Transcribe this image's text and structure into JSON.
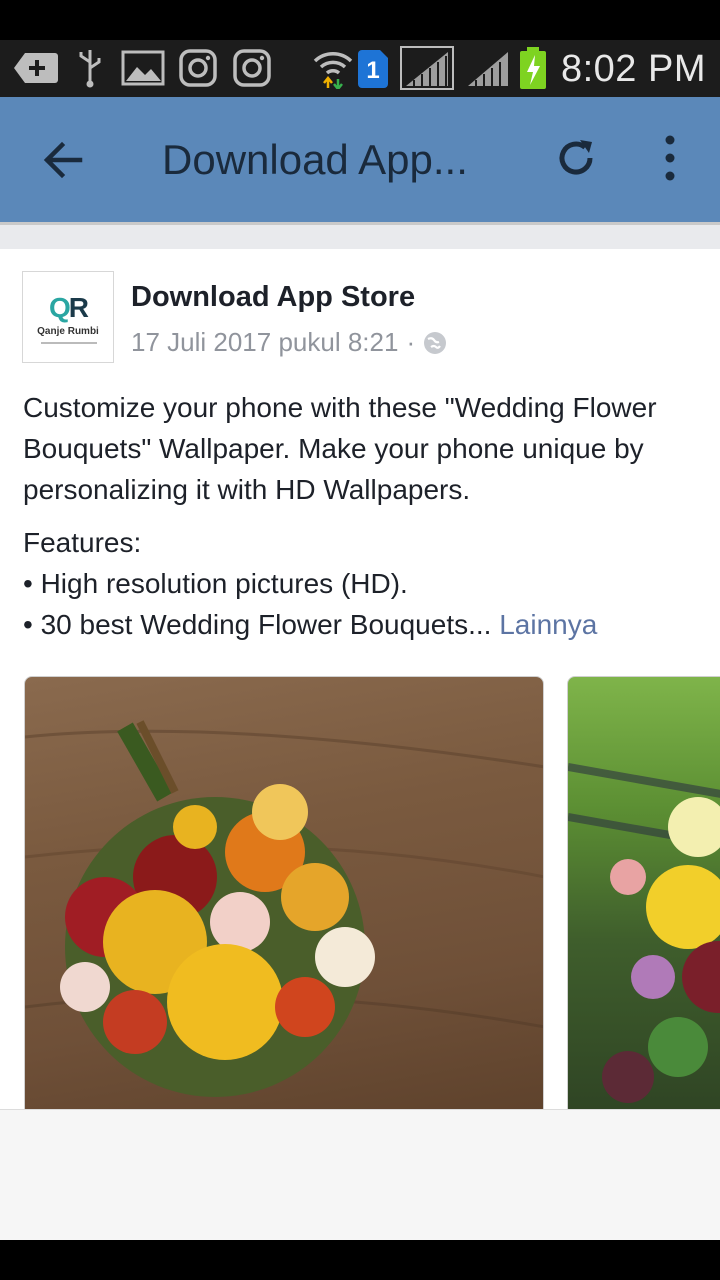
{
  "status_bar": {
    "time": "8:02 PM",
    "icons": [
      "add-notification-icon",
      "usb-icon",
      "image-icon",
      "instagram-icon",
      "instagram-icon",
      "wifi-icon",
      "sim-1-icon",
      "signal-icon",
      "signal-icon",
      "battery-charging-icon"
    ],
    "sim_label": "1"
  },
  "app_bar": {
    "title": "Download App...",
    "background": "#5b88b9"
  },
  "post": {
    "avatar": {
      "logo_text_primary": "Q",
      "logo_text_secondary": "R",
      "brand_text": "Qanje Rumbi"
    },
    "page_name": "Download App Store",
    "timestamp": "17 Juli 2017 pukul 8:21",
    "separator": "·",
    "body": "Customize your phone with these \"Wedding Flower Bouquets\" Wallpaper. Make your phone unique by personalizing it with HD Wallpapers.",
    "features_heading": "Features:",
    "features": [
      "• High resolution pictures (HD).",
      "• 30 best Wedding Flower Bouquets..."
    ],
    "see_more": "Lainnya"
  },
  "colors": {
    "link": "#5c74a3",
    "text": "#1d2129",
    "meta": "#90949c"
  }
}
